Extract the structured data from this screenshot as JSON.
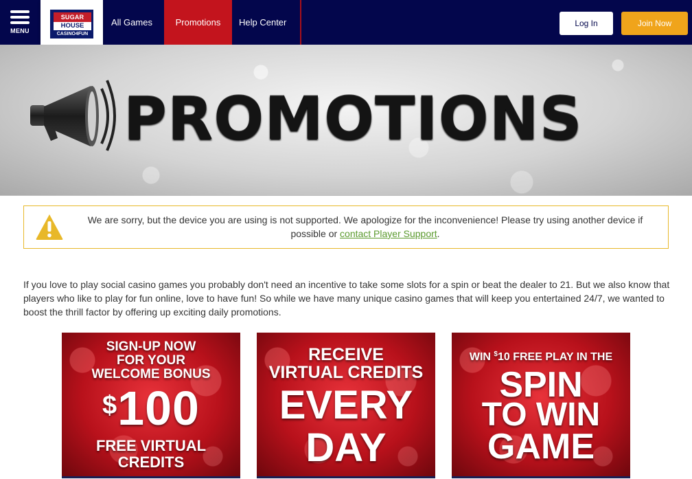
{
  "nav": {
    "menu_label": "MENU",
    "logo": {
      "line1": "SUGAR",
      "line2": "HOUSE",
      "line3": "CASINO4FUN"
    },
    "links": [
      "All Games",
      "Promotions",
      "Help Center"
    ],
    "login_label": "Log In",
    "join_label": "Join Now",
    "colors": {
      "bar": "#03064c",
      "active": "#c3141d",
      "join": "#f0a41b"
    }
  },
  "hero": {
    "title": "PROMOTIONS"
  },
  "alert": {
    "text": "We are sorry, but the device you are using is not supported. We apologize for the inconvenience! Please try using another device if possible or ",
    "link": "contact Player Support",
    "end": "."
  },
  "intro": "If you love to play social casino games you probably don't need an incentive to take some slots for a spin or beat the dealer to 21. But we also know that players who like to play for fun online, love to have fun! So while we have many unique casino games that will keep you entertained 24/7, we wanted to boost the thrill factor by offering up exciting daily promotions.",
  "cards": [
    {
      "line1": "SIGN-UP NOW",
      "line2": "FOR YOUR",
      "line3": "WELCOME BONUS",
      "dollar": "$",
      "amount": "100",
      "line4": "FREE VIRTUAL",
      "line5": "CREDITS"
    },
    {
      "line1": "RECEIVE",
      "line2": "VIRTUAL CREDITS",
      "line3": "EVERY",
      "line4": "DAY"
    },
    {
      "line1a": "WIN ",
      "dollar": "$",
      "line1b": "10 FREE PLAY IN THE",
      "line2": "SPIN",
      "line3": "TO WIN",
      "line4": "GAME"
    }
  ]
}
